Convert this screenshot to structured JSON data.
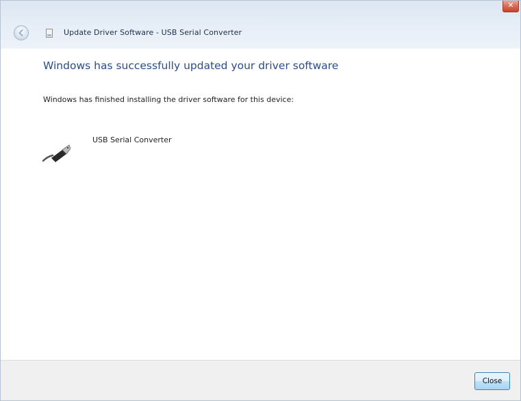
{
  "window": {
    "title": "Update Driver Software - USB Serial Converter",
    "close_glyph": "✕"
  },
  "icons": {
    "back": "back-arrow-icon",
    "title": "driver-page-icon",
    "device": "usb-plug-icon",
    "close": "close-icon"
  },
  "main": {
    "heading": "Windows has successfully updated your driver software",
    "subtitle": "Windows has finished installing the driver software for this device:",
    "device_name": "USB Serial Converter"
  },
  "footer": {
    "close_label": "Close"
  },
  "colors": {
    "heading": "#2b4b8a",
    "titlebar": "#dce7f3",
    "close_button_border": "#3c7fb1",
    "window_close": "#c8432b"
  }
}
